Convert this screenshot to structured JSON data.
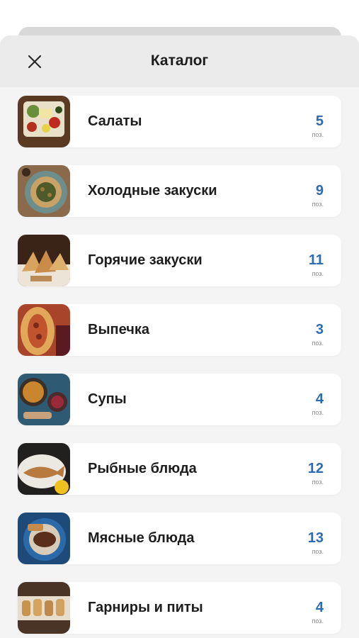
{
  "header": {
    "title": "Каталог",
    "close_icon": "close-icon"
  },
  "colors": {
    "accent": "#2b6cb4",
    "header_bg": "#ebebeb",
    "list_bg": "#f4f4f4"
  },
  "categories": [
    {
      "label": "Салаты",
      "count": "5",
      "unit": "поз."
    },
    {
      "label": "Холодные закуски",
      "count": "9",
      "unit": "поз."
    },
    {
      "label": "Горячие закуски",
      "count": "11",
      "unit": "поз."
    },
    {
      "label": "Выпечка",
      "count": "3",
      "unit": "поз."
    },
    {
      "label": "Супы",
      "count": "4",
      "unit": "поз."
    },
    {
      "label": "Рыбные блюда",
      "count": "12",
      "unit": "поз."
    },
    {
      "label": "Мясные блюда",
      "count": "13",
      "unit": "поз."
    },
    {
      "label": "Гарниры и питы",
      "count": "4",
      "unit": "поз."
    }
  ]
}
